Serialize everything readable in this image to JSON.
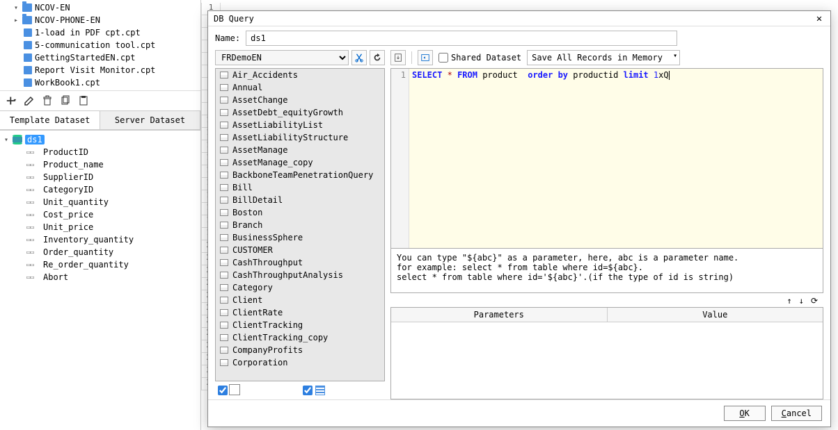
{
  "file_tree": {
    "folders": [
      {
        "name": "NCOV-EN",
        "expanded": true
      },
      {
        "name": "NCOV-PHONE-EN",
        "expanded": false
      }
    ],
    "files": [
      "1-load in PDF cpt.cpt",
      "5-communication tool.cpt",
      "GettingStartedEN.cpt",
      "Report Visit Monitor.cpt",
      "WorkBook1.cpt"
    ]
  },
  "dataset_tabs": {
    "template": "Template Dataset",
    "server": "Server Dataset"
  },
  "dataset": {
    "name": "ds1",
    "columns": [
      "ProductID",
      "Product_name",
      "SupplierID",
      "CategoryID",
      "Unit_quantity",
      "Cost_price",
      "Unit_price",
      "Inventory_quantity",
      "Order_quantity",
      "Re_order_quantity",
      "Abort"
    ]
  },
  "dialog": {
    "title": "DB Query",
    "name_label": "Name:",
    "name_value": "ds1",
    "connection": "FRDemoEN",
    "tables": [
      "Air_Accidents",
      "Annual",
      "AssetChange",
      "AssetDebt_equityGrowth",
      "AssetLiabilityList",
      "AssetLiabilityStructure",
      "AssetManage",
      "AssetManage_copy",
      "BackboneTeamPenetrationQuery",
      "Bill",
      "BillDetail",
      "Boston",
      "Branch",
      "BusinessSphere",
      "CUSTOMER",
      "CashThroughput",
      "CashThroughputAnalysis",
      "Category",
      "Client",
      "ClientRate",
      "ClientTracking",
      "ClientTracking_copy",
      "CompanyProfits",
      "Corporation"
    ],
    "shared_label": "Shared Dataset",
    "memory_option": "Save All Records in Memory",
    "sql_line_num": "1",
    "sql_kw1": "SELECT",
    "sql_op": "*",
    "sql_kw2": "FROM",
    "sql_ident": "product",
    "sql_kw3": "order by",
    "sql_ident2": "productid",
    "sql_kw4": "limit",
    "sql_num": "1",
    "sql_tail": "xQ",
    "help_text": "You can type \"${abc}\" as a parameter, here, abc is a parameter name.\nfor example: select * from table where id=${abc}.\nselect * from table where id='${abc}'.(if the type of id is string)",
    "param_headers": {
      "param": "Parameters",
      "value": "Value"
    },
    "buttons": {
      "ok": "OK",
      "ok_u": "O",
      "ok_rest": "K",
      "cancel": "Cancel",
      "cancel_u": "C",
      "cancel_rest": "ancel"
    }
  }
}
